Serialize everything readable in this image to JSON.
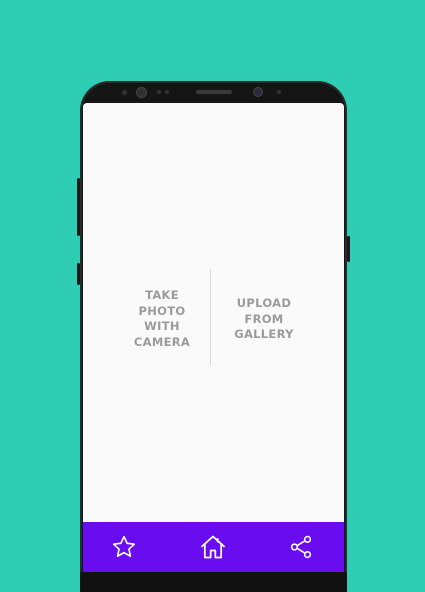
{
  "screen": {
    "options": {
      "camera_label": "TAKE\nPHOTO\nWITH\nCAMERA",
      "gallery_label": "UPLOAD\nFROM\nGALLERY"
    }
  },
  "navbar": {
    "items": [
      {
        "icon": "star-icon"
      },
      {
        "icon": "home-icon"
      },
      {
        "icon": "share-icon"
      }
    ]
  },
  "colors": {
    "background": "#2ecdb4",
    "navbar": "#6a0cf0",
    "screen": "#fafafa",
    "option_text": "#9b9b9b",
    "phone_body": "#151515"
  }
}
